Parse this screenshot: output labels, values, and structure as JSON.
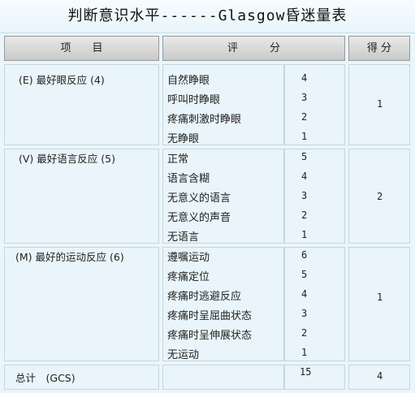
{
  "title": "判断意识水平------Glasgow昏迷量表",
  "header": {
    "item": "项　　目",
    "score": "评　　　分",
    "points": "得 分"
  },
  "sections": [
    {
      "label": "(E) 最好眼反应 (4)",
      "score": "1",
      "rows": [
        {
          "text": "自然睁眼",
          "value": "4"
        },
        {
          "text": "呼叫时睁眼",
          "value": "3"
        },
        {
          "text": "疼痛刺激时睁眼",
          "value": "2"
        },
        {
          "text": "无睁眼",
          "value": "1"
        }
      ]
    },
    {
      "label": "(V) 最好语言反应 (5)",
      "score": "2",
      "rows": [
        {
          "text": "正常",
          "value": "5"
        },
        {
          "text": "语言含糊",
          "value": "4"
        },
        {
          "text": "无意义的语言",
          "value": "3"
        },
        {
          "text": "无意义的声音",
          "value": "2"
        },
        {
          "text": "无语言",
          "value": "1"
        }
      ]
    },
    {
      "label": "(M) 最好的运动反应 (6)",
      "score": "1",
      "rows": [
        {
          "text": "遵嘱运动",
          "value": "6"
        },
        {
          "text": "疼痛定位",
          "value": "5"
        },
        {
          "text": "疼痛时逃避反应",
          "value": "4"
        },
        {
          "text": "疼痛时呈屈曲状态",
          "value": "3"
        },
        {
          "text": "疼痛时呈伸展状态",
          "value": "2"
        },
        {
          "text": "无运动",
          "value": "1"
        }
      ]
    }
  ],
  "total": {
    "label": "总计　(GCS)",
    "value": "15",
    "score": "4"
  }
}
